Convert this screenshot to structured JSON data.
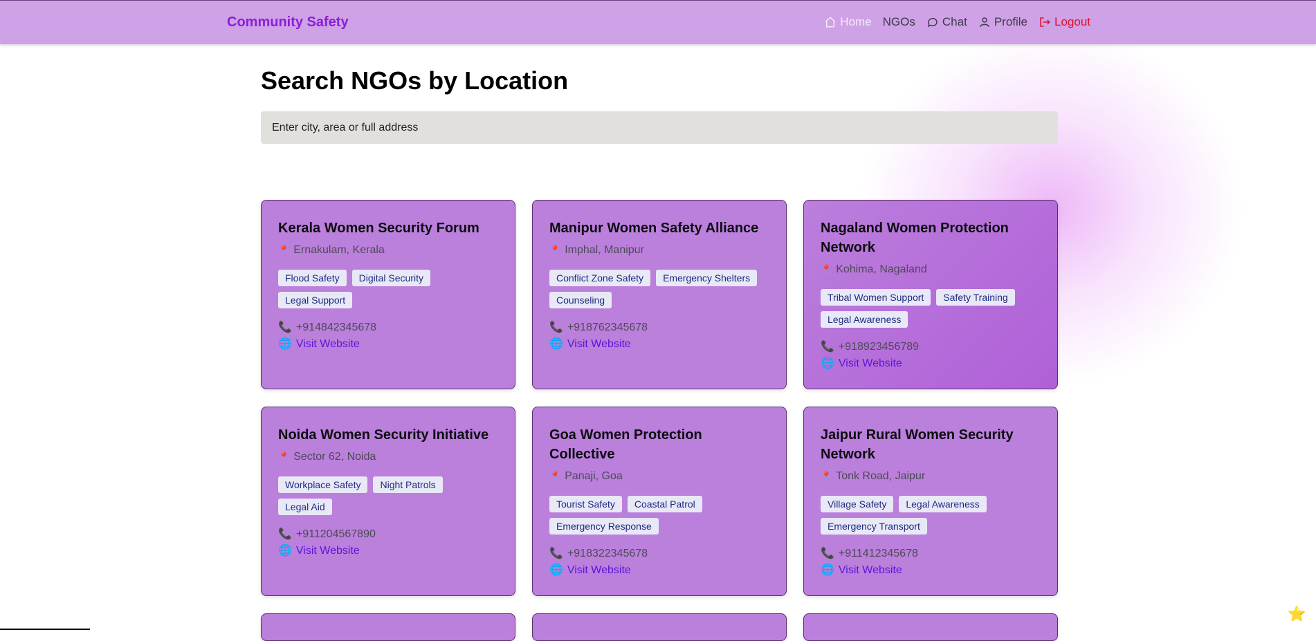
{
  "nav": {
    "brand": "Community Safety",
    "links": {
      "home": "Home",
      "ngos": "NGOs",
      "chat": "Chat",
      "profile": "Profile",
      "logout": "Logout"
    }
  },
  "page": {
    "title": "Search NGOs by Location",
    "search_placeholder": "Enter city, area or full address"
  },
  "cards": [
    {
      "name": "Kerala Women Security Forum",
      "location": "Ernakulam, Kerala",
      "tags": [
        "Flood Safety",
        "Digital Security",
        "Legal Support"
      ],
      "phone": "+914842345678",
      "website_label": "Visit Website"
    },
    {
      "name": "Manipur Women Safety Alliance",
      "location": "Imphal, Manipur",
      "tags": [
        "Conflict Zone Safety",
        "Emergency Shelters",
        "Counseling"
      ],
      "phone": "+918762345678",
      "website_label": "Visit Website"
    },
    {
      "name": "Nagaland Women Protection Network",
      "location": "Kohima, Nagaland",
      "tags": [
        "Tribal Women Support",
        "Safety Training",
        "Legal Awareness"
      ],
      "phone": "+918923456789",
      "website_label": "Visit Website"
    },
    {
      "name": "Noida Women Security Initiative",
      "location": "Sector 62, Noida",
      "tags": [
        "Workplace Safety",
        "Night Patrols",
        "Legal Aid"
      ],
      "phone": "+911204567890",
      "website_label": "Visit Website"
    },
    {
      "name": "Goa Women Protection Collective",
      "location": "Panaji, Goa",
      "tags": [
        "Tourist Safety",
        "Coastal Patrol",
        "Emergency Response"
      ],
      "phone": "+918322345678",
      "website_label": "Visit Website"
    },
    {
      "name": "Jaipur Rural Women Security Network",
      "location": "Tonk Road, Jaipur",
      "tags": [
        "Village Safety",
        "Legal Awareness",
        "Emergency Transport"
      ],
      "phone": "+911412345678",
      "website_label": "Visit Website"
    }
  ],
  "icons": {
    "location": "pin-icon",
    "phone": "phone-icon",
    "website": "globe-icon",
    "floating": "star-icon"
  },
  "colors": {
    "navbar": "#cfa1e6",
    "brand": "#8a1fd8",
    "card": "#bb7fdc",
    "logout": "#e0102c",
    "link": "#5a16d8",
    "tag_bg": "#e8e8f6"
  }
}
